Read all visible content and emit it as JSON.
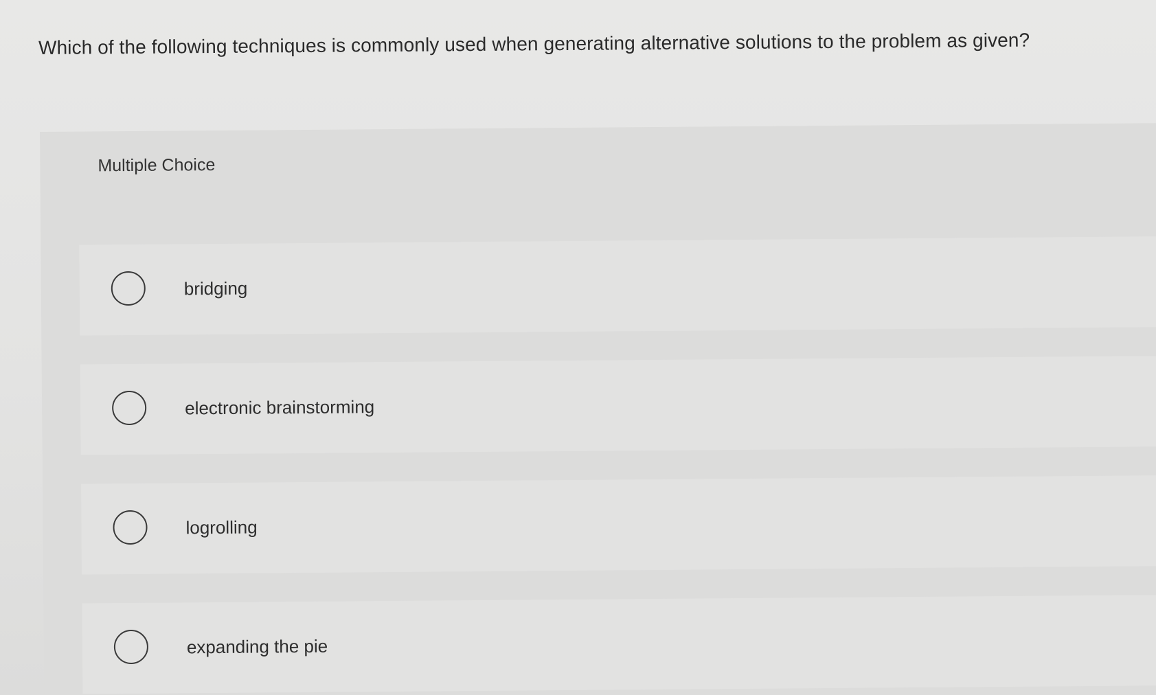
{
  "question": {
    "text": "Which of the following techniques is commonly used when generating alternative solutions to the problem as given?"
  },
  "multiple_choice": {
    "label": "Multiple Choice",
    "options": [
      {
        "label": "bridging"
      },
      {
        "label": "electronic brainstorming"
      },
      {
        "label": "logrolling"
      },
      {
        "label": "expanding the pie"
      }
    ]
  }
}
